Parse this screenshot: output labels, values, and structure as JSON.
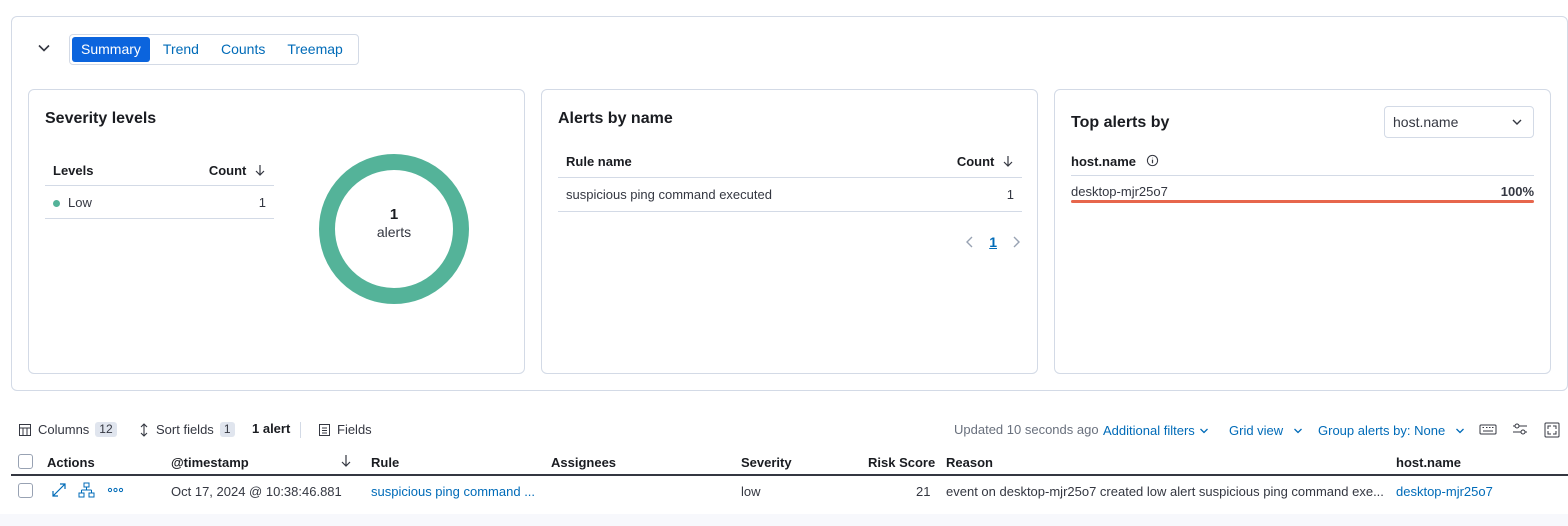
{
  "tabs": [
    {
      "label": "Summary",
      "active": true
    },
    {
      "label": "Trend",
      "active": false
    },
    {
      "label": "Counts",
      "active": false
    },
    {
      "label": "Treemap",
      "active": false
    }
  ],
  "severity": {
    "title": "Severity levels",
    "col_levels": "Levels",
    "col_count": "Count",
    "rows": [
      {
        "level": "Low",
        "count": "1",
        "color": "#54b399"
      }
    ],
    "donut_value": "1",
    "donut_label": "alerts"
  },
  "alerts_by_name": {
    "title": "Alerts by name",
    "col_rule": "Rule name",
    "col_count": "Count",
    "rows": [
      {
        "rule": "suspicious ping command executed",
        "count": "1"
      }
    ],
    "page": "1"
  },
  "top_alerts": {
    "title": "Top alerts by",
    "selected_field": "host.name",
    "col_field": "host.name",
    "rows": [
      {
        "host": "desktop-mjr25o7",
        "pct_label": "100%",
        "fraction": 1.0,
        "color": "#e7664c"
      }
    ]
  },
  "toolbar": {
    "columns_label": "Columns",
    "columns_count": "12",
    "sort_label": "Sort fields",
    "sort_count": "1",
    "alert_count": "1 alert",
    "fields_label": "Fields",
    "updated": "Updated 10 seconds ago",
    "additional_filters": "Additional filters",
    "grid_view": "Grid view",
    "group_by": "Group alerts by: None"
  },
  "grid": {
    "headers": {
      "actions": "Actions",
      "timestamp": "@timestamp",
      "rule": "Rule",
      "assignees": "Assignees",
      "severity": "Severity",
      "risk": "Risk Score",
      "reason": "Reason",
      "host": "host.name"
    },
    "rows": [
      {
        "timestamp": "Oct 17, 2024 @ 10:38:46.881",
        "rule": "suspicious ping command ...",
        "assignees": "",
        "severity": "low",
        "risk": "21",
        "reason": "event on desktop-mjr25o7 created low alert suspicious ping command exe...",
        "host": "desktop-mjr25o7"
      }
    ]
  },
  "colors": {
    "accent": "#0b64dd",
    "link": "#006bb8",
    "donut": "#54b399",
    "bar": "#e7664c"
  }
}
